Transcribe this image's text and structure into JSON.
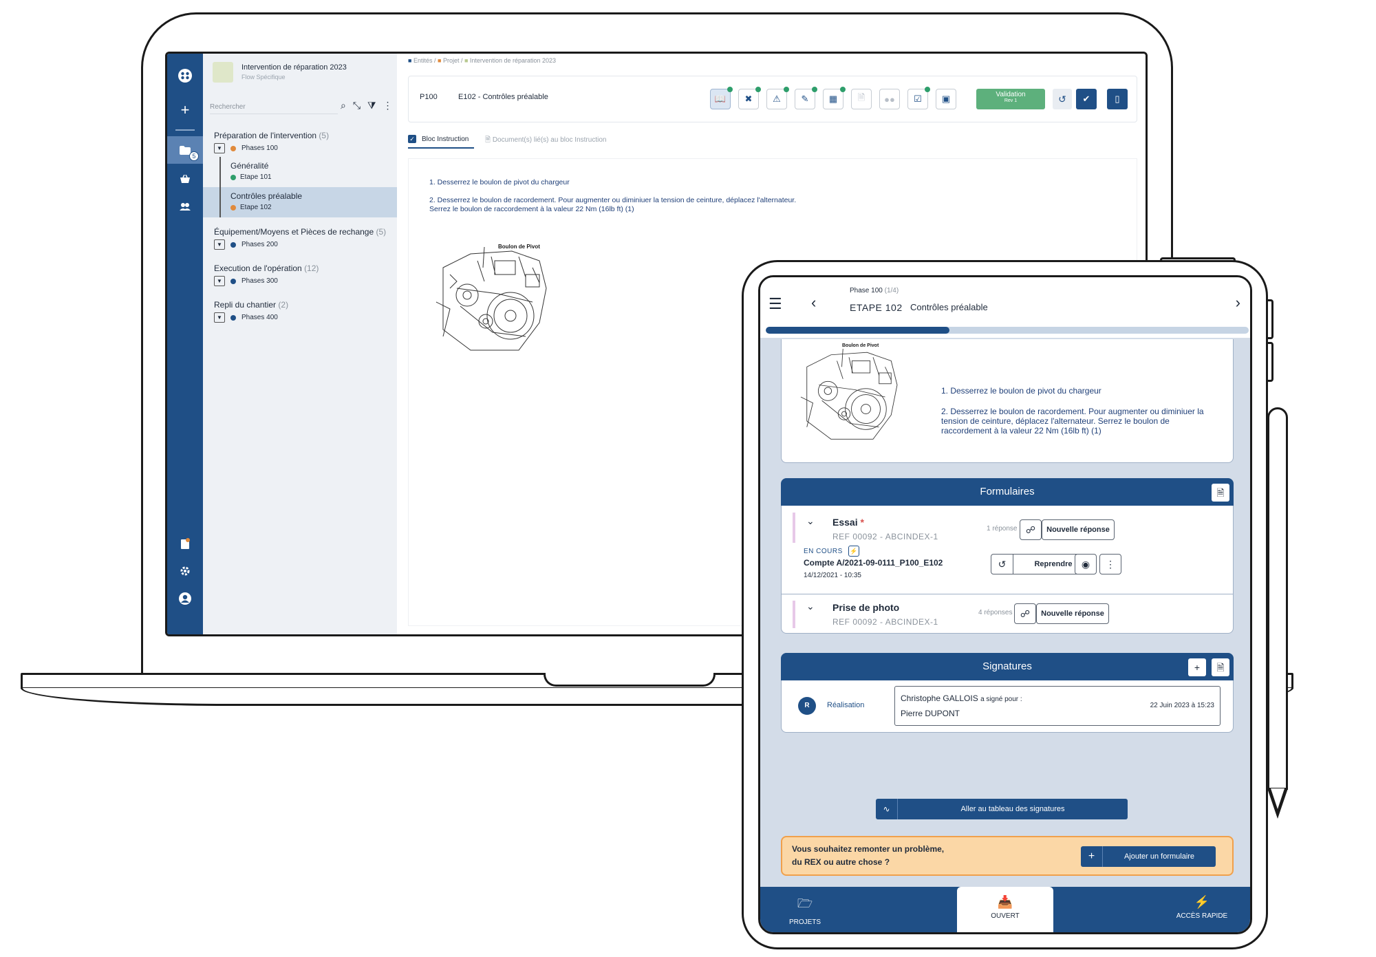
{
  "laptop": {
    "rail": {
      "badge": "5"
    },
    "tree": {
      "project_title": "Intervention de réparation 2023",
      "project_subtitle": "Flow Spécifique",
      "search_placeholder": "Rechercher",
      "phases": [
        {
          "name": "Préparation de l'intervention",
          "count": "(5)",
          "sub": "Phases 100",
          "color": "#e08a3c"
        },
        {
          "name": "Équipement/Moyens et Pièces de rechange",
          "count": "(5)",
          "sub": "Phases 200",
          "color": "#1f4f86"
        },
        {
          "name": "Execution de l'opération",
          "count": "(12)",
          "sub": "Phases 300",
          "color": "#1f4f86"
        },
        {
          "name": "Repli du chantier",
          "count": "(2)",
          "sub": "Phases 400",
          "color": "#1f4f86"
        }
      ],
      "steps": [
        {
          "name": "Généralité",
          "sub": "Etape 101",
          "color": "#2e9e6b"
        },
        {
          "name": "Contrôles préalable",
          "sub": "Etape 102",
          "color": "#e08a3c"
        }
      ]
    },
    "breadcrumb": [
      "Entités",
      "Projet",
      "Intervention de réparation 2023"
    ],
    "toolbar": {
      "phase": "P100",
      "step": "E102 - Contrôles préalable",
      "validation": "Validation",
      "validation_sub": "Rev 1"
    },
    "tabs": {
      "bloc": "Bloc Instruction",
      "docs": "Document(s) lié(s) au bloc Instruction"
    },
    "instructions": {
      "line1": "1. Desserrez le boulon de pivot du chargeur",
      "line2": "2. Desserrez le boulon de racordement. Pour augmenter ou diminiuer la tension de ceinture, déplacez l'alternateur.",
      "line3": "Serrez le boulon de raccordement à la valeur 22 Nm (16lb ft) (1)",
      "image_label": "Boulon de Pivot"
    }
  },
  "tablet": {
    "header": {
      "phase": "Phase 100",
      "phase_count": "(1/4)",
      "step": "ETAPE 102",
      "title": "Contrôles préalable",
      "progress": 0.38
    },
    "instructions": {
      "image_label": "Boulon de Pivot",
      "line1": "1. Desserrez le boulon de pivot du chargeur",
      "line2": "2. Desserrez le boulon de racordement. Pour augmenter ou diminiuer la tension de ceinture, déplacez l'alternateur. Serrez le boulon de raccordement à la valeur 22 Nm (16lb ft) (1)"
    },
    "forms": {
      "title": "Formulaires",
      "items": [
        {
          "name": "Essai",
          "required": "*",
          "ref": "REF 00092 - ABCINDEX-1",
          "count": "1 réponse",
          "new_label": "Nouvelle réponse",
          "status": "EN COURS",
          "account": "Compte A/2021-09-0111_P100_E102",
          "date": "14/12/2021 - 10:35",
          "resume_label": "Reprendre"
        },
        {
          "name": "Prise de photo",
          "ref": "REF 00092 - ABCINDEX-1",
          "count": "4 réponses",
          "new_label": "Nouvelle réponse"
        }
      ]
    },
    "signatures": {
      "title": "Signatures",
      "avatar": "R",
      "role": "Réalisation",
      "signer": "Christophe GALLOIS",
      "signed_for": "a signé pour :",
      "for_person": "Pierre DUPONT",
      "date": "22 Juin 2023 à 15:23",
      "table_link": "Aller au tableau des signatures"
    },
    "banner": {
      "line1": "Vous souhaitez remonter un problème,",
      "line2": "du REX ou autre chose ?",
      "button": "Ajouter un formulaire"
    },
    "nav": [
      "PROJETS",
      "OUVERT",
      "ACCÈS RAPIDE"
    ]
  }
}
